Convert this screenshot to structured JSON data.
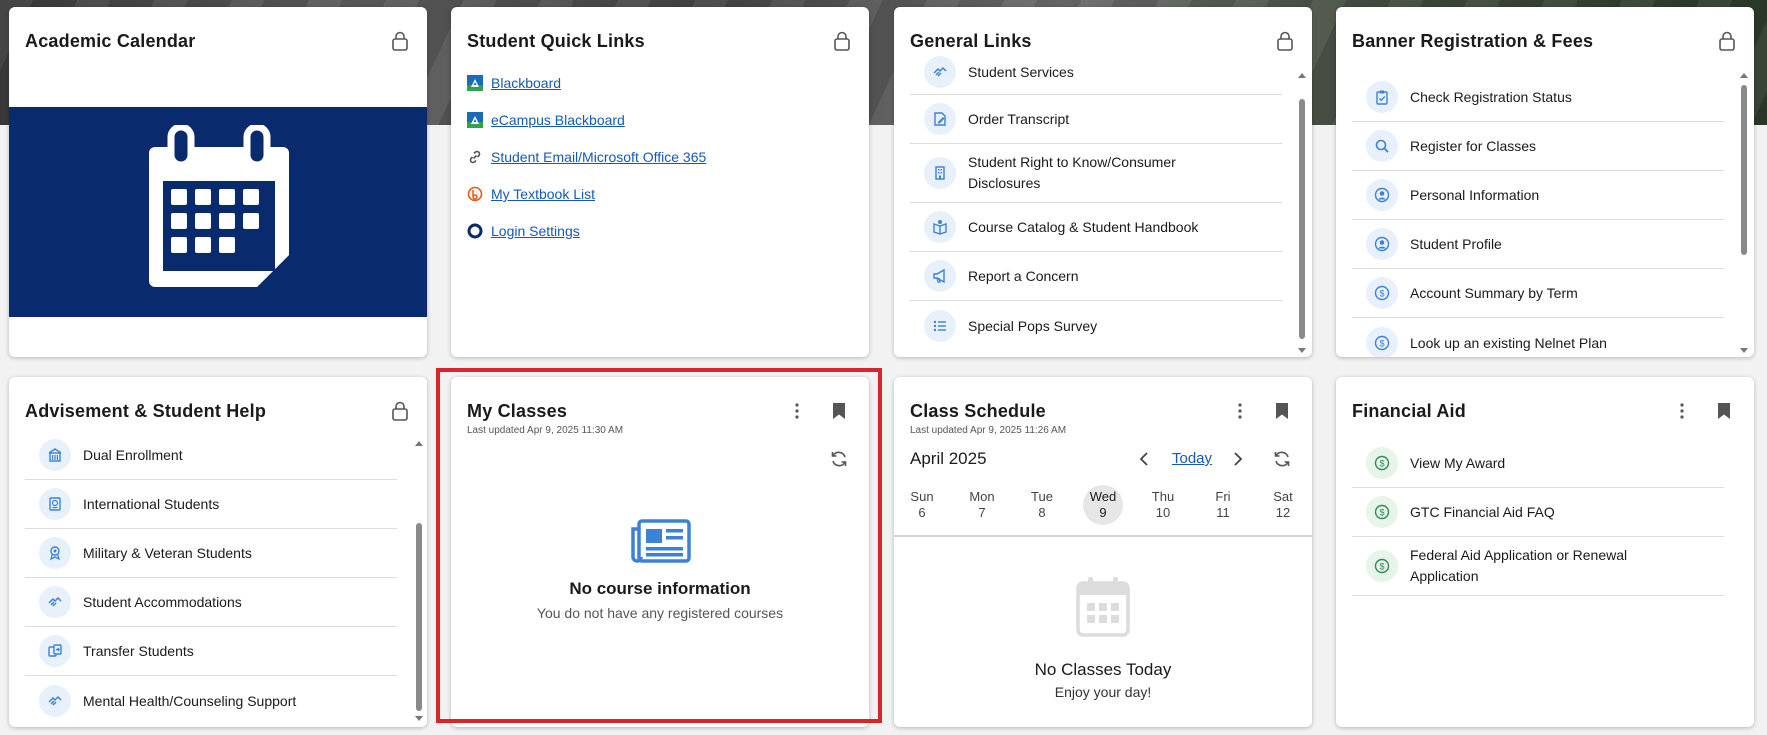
{
  "academic_calendar": {
    "title": "Academic Calendar"
  },
  "quick_links": {
    "title": "Student Quick Links",
    "links": [
      {
        "label": "Blackboard",
        "icon": "blackboard-icon"
      },
      {
        "label": "eCampus Blackboard",
        "icon": "blackboard-icon"
      },
      {
        "label": "Student Email/Microsoft Office 365",
        "icon": "link-icon"
      },
      {
        "label": "My Textbook List",
        "icon": "textbook-icon"
      },
      {
        "label": "Login Settings",
        "icon": "circle-icon"
      }
    ]
  },
  "general_links": {
    "title": "General Links",
    "items": [
      {
        "label": "Student Services",
        "icon": "handshake-icon"
      },
      {
        "label": "Order Transcript",
        "icon": "edit-document-icon"
      },
      {
        "label": "Student Right to Know/Consumer Disclosures",
        "line1": "Student Right to Know/Consumer",
        "line2": "Disclosures",
        "icon": "building-icon"
      },
      {
        "label": "Course Catalog & Student Handbook",
        "icon": "book-icon"
      },
      {
        "label": "Report a Concern",
        "icon": "megaphone-icon"
      },
      {
        "label": "Special Pops Survey",
        "icon": "list-icon"
      }
    ]
  },
  "banner": {
    "title": "Banner Registration & Fees",
    "items": [
      {
        "label": "Check Registration Status",
        "icon": "clipboard-check-icon"
      },
      {
        "label": "Register for Classes",
        "icon": "search-icon"
      },
      {
        "label": "Personal Information",
        "icon": "user-circle-icon"
      },
      {
        "label": "Student Profile",
        "icon": "user-circle-icon"
      },
      {
        "label": "Account Summary by Term",
        "icon": "dollar-circle-icon"
      },
      {
        "label": "Look up an existing Nelnet Plan",
        "icon": "dollar-circle-icon"
      }
    ]
  },
  "advisement": {
    "title": "Advisement & Student Help",
    "items": [
      {
        "label": "Dual Enrollment",
        "icon": "school-icon"
      },
      {
        "label": "International Students",
        "icon": "passport-icon"
      },
      {
        "label": "Military & Veteran Students",
        "icon": "medal-icon"
      },
      {
        "label": "Student Accommodations",
        "icon": "handshake-icon"
      },
      {
        "label": "Transfer Students",
        "icon": "transfer-icon"
      },
      {
        "label": "Mental Health/Counseling Support",
        "icon": "handshake-icon"
      }
    ]
  },
  "my_classes": {
    "title": "My Classes",
    "updated": "Last updated Apr 9, 2025 11:30 AM",
    "empty_title": "No course information",
    "empty_text": "You do not have any registered courses",
    "highlight_color": "#d9252a"
  },
  "class_schedule": {
    "title": "Class Schedule",
    "updated": "Last updated Apr 9, 2025 11:26 AM",
    "month": "April 2025",
    "today_label": "Today",
    "days": [
      {
        "name": "Sun",
        "num": "6"
      },
      {
        "name": "Mon",
        "num": "7"
      },
      {
        "name": "Tue",
        "num": "8"
      },
      {
        "name": "Wed",
        "num": "9",
        "selected": true
      },
      {
        "name": "Thu",
        "num": "10"
      },
      {
        "name": "Fri",
        "num": "11"
      },
      {
        "name": "Sat",
        "num": "12"
      }
    ],
    "empty_title": "No Classes Today",
    "empty_text": "Enjoy your day!"
  },
  "financial_aid": {
    "title": "Financial Aid",
    "items": [
      {
        "label": "View My Award",
        "icon": "dollar-circle-icon"
      },
      {
        "label": "GTC Financial Aid FAQ",
        "icon": "dollar-circle-icon"
      },
      {
        "label": "Federal Aid Application or Renewal Application",
        "line1": "Federal Aid Application or Renewal",
        "line2": "Application",
        "icon": "dollar-circle-icon"
      }
    ]
  },
  "colors": {
    "calendar_bg": "#0a2a6e",
    "link": "#1559b3",
    "icon_blue": "#3b82d6",
    "icon_green": "#2e8b57"
  }
}
